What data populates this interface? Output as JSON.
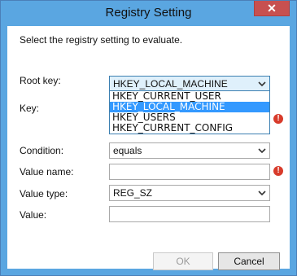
{
  "window": {
    "title": "Registry Setting",
    "close_symbol": "✕"
  },
  "instruction": "Select the registry setting to evaluate.",
  "root_key": {
    "label": "Root key:",
    "value": "HKEY_LOCAL_MACHINE",
    "options": [
      "HKEY_CURRENT_USER",
      "HKEY_LOCAL_MACHINE",
      "HKEY_USERS",
      "HKEY_CURRENT_CONFIG"
    ],
    "selected_option": "HKEY_LOCAL_MACHINE"
  },
  "key": {
    "label": "Key:",
    "value": ""
  },
  "condition": {
    "label": "Condition:",
    "value": "equals"
  },
  "value_name": {
    "label": "Value name:",
    "value": ""
  },
  "value_type": {
    "label": "Value type:",
    "value": "REG_SZ"
  },
  "value": {
    "label": "Value:",
    "value": ""
  },
  "buttons": {
    "ok": "OK",
    "cancel": "Cancel"
  },
  "colors": {
    "titlebar": "#5aa6e1",
    "close": "#c75050",
    "selection": "#3399ff",
    "error": "#d83b2b"
  },
  "icons": {
    "error": "!",
    "error_name": "error-icon",
    "dropdown_name": "chevron-down-icon"
  }
}
